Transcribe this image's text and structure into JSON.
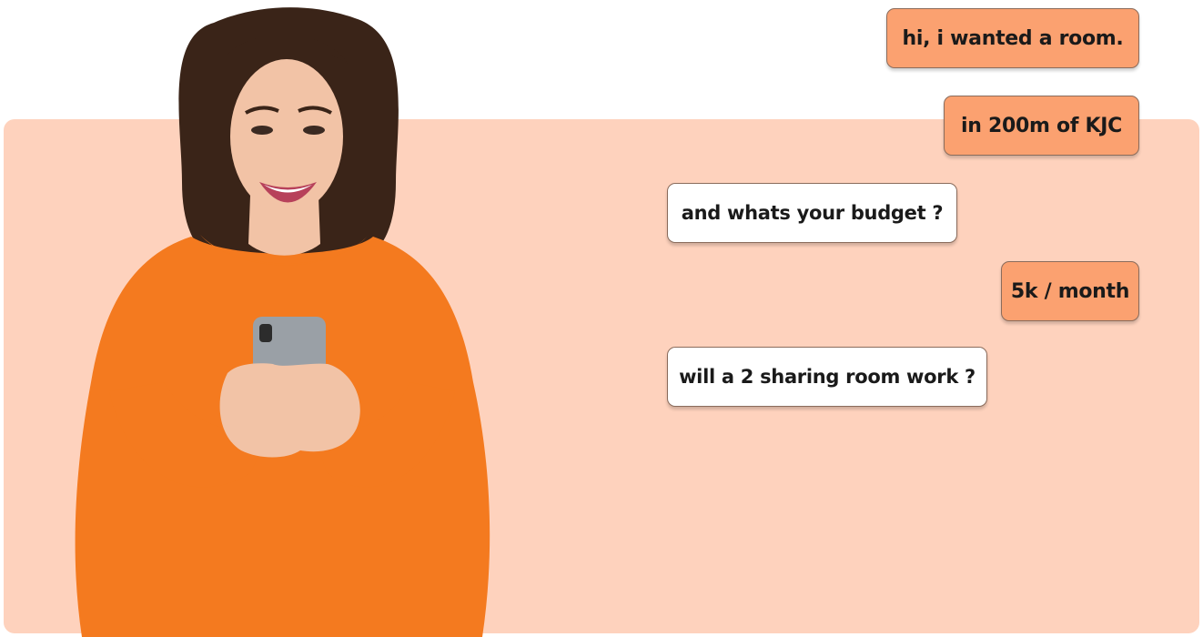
{
  "colors": {
    "page_background": "#ffffff",
    "panel_background": "#fed2bd",
    "sent_bubble": "#fba170",
    "received_bubble": "#ffffff",
    "sweater": "#f47a1f",
    "hair": "#3a2418",
    "skin": "#f2c3a6"
  },
  "illustration": {
    "subject": "woman in orange sweater smiling at phone"
  },
  "chat": {
    "messages": [
      {
        "sender": "user",
        "text": "hi, i wanted a room."
      },
      {
        "sender": "user",
        "text": "in 200m of KJC"
      },
      {
        "sender": "agent",
        "text": "and whats your budget ?"
      },
      {
        "sender": "user",
        "text": "5k / month"
      },
      {
        "sender": "agent",
        "text": "will a 2 sharing room work ?"
      }
    ]
  }
}
